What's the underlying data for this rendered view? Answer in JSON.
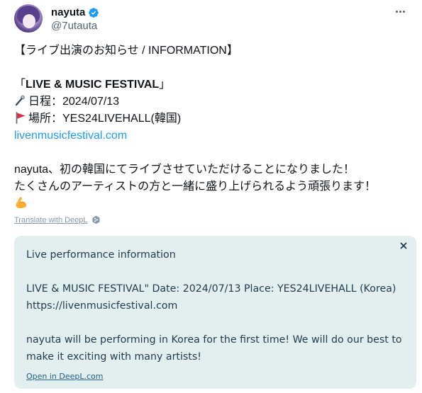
{
  "user": {
    "display_name": "nayuta",
    "handle": "@7utauta"
  },
  "tweet": {
    "heading": "【ライブ出演のお知らせ / INFORMATION】",
    "event_open": "「",
    "event_name": "LIVE & MUSIC FESTIVAL",
    "event_close": "」",
    "date_line": "日程：2024/07/13",
    "place_line": "場所：YES24LIVEHALL(韓国)",
    "link": "livenmusicfestival.com",
    "body_line1": "nayuta、初の韓国にてライブさせていただけることになりました！",
    "body_line2": "たくさんのアーティストの方と一緒に盛り上げられるよう頑張ります！"
  },
  "translate_link": "Translate with DeepL",
  "translation": {
    "line1": "Live performance information",
    "line2": "LIVE & MUSIC FESTIVAL\" Date: 2024/07/13 Place: YES24LIVEHALL (Korea)",
    "line3": "https://livenmusicfestival.com",
    "line4": "nayuta will be performing in Korea for the first time! We will do our best to",
    "line5": "make it exciting with many artists!",
    "open_link": "Open in DeepL.com"
  },
  "colors": {
    "link": "#1d9bf0",
    "verified": "#1d9bf0",
    "translation_bg": "#e3eeee"
  },
  "icons": [
    "verified-badge-icon",
    "more-icon",
    "microphone-icon",
    "flag-icon",
    "flexed-biceps-icon",
    "deepl-icon",
    "close-icon"
  ]
}
